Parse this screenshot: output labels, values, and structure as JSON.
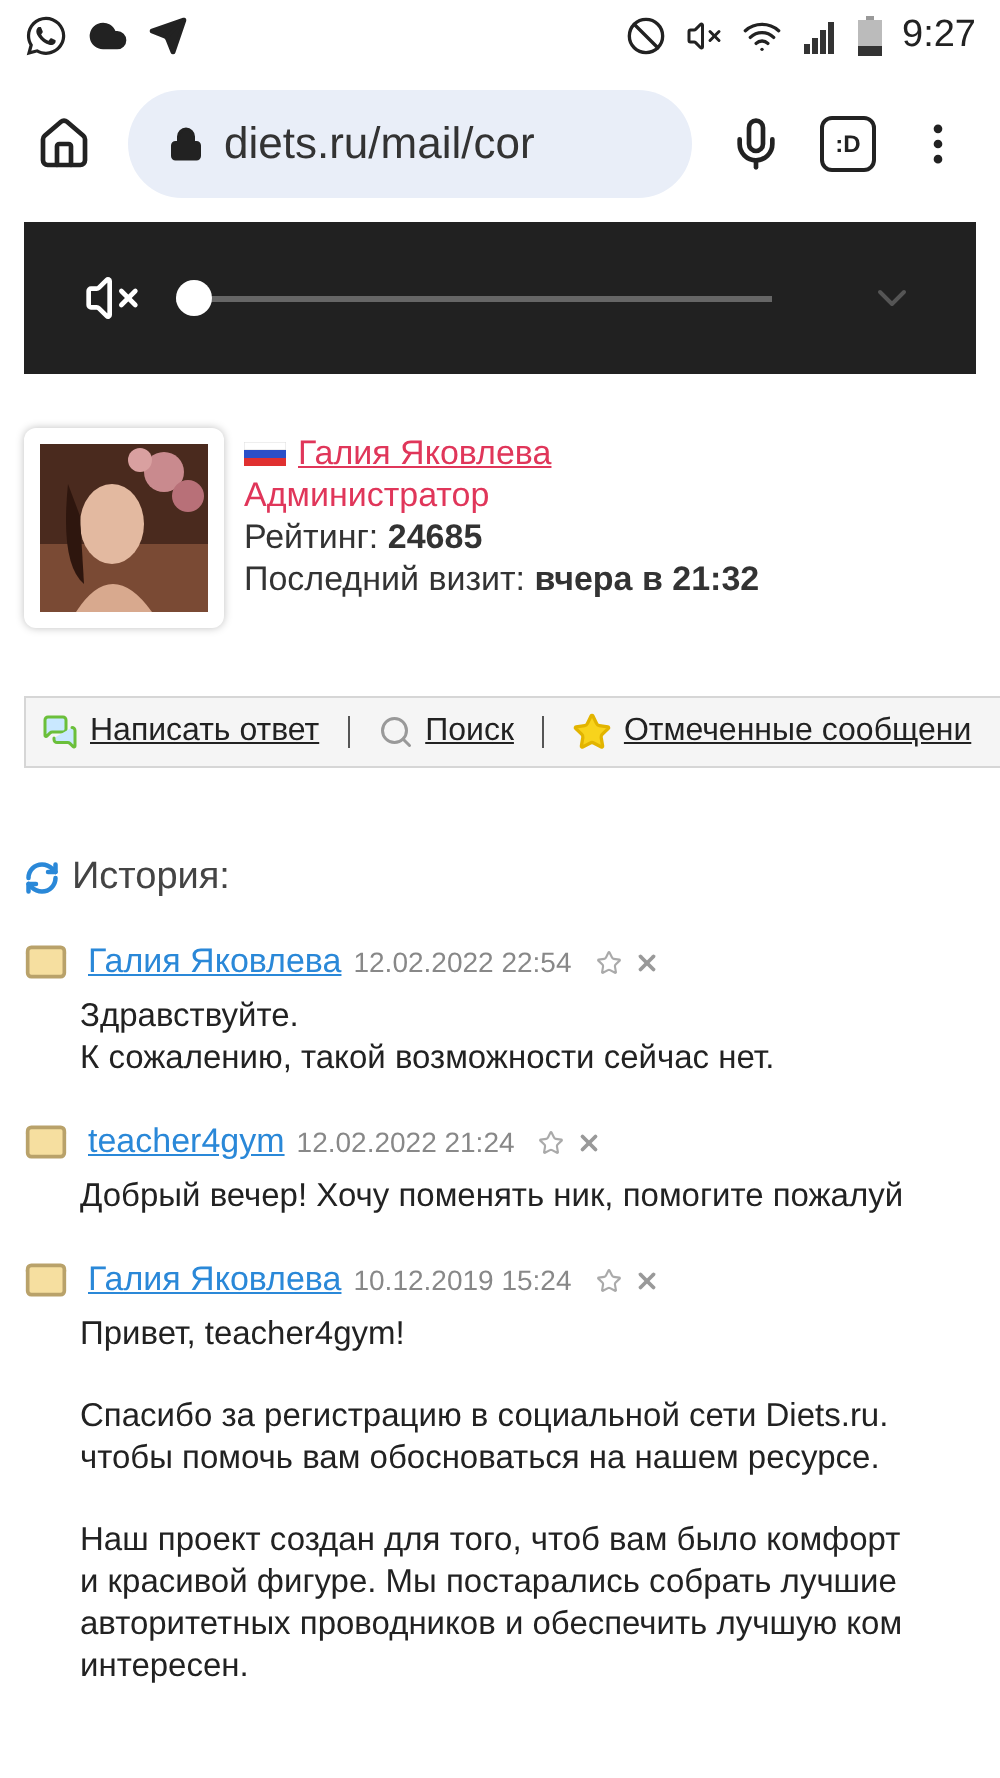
{
  "status_bar": {
    "time": "9:27"
  },
  "browser": {
    "url": "diets.ru/mail/cor",
    "tab_switcher": ":D"
  },
  "media_overlay": {
    "muted": true,
    "level": 0
  },
  "profile": {
    "name": "Галия Яковлева",
    "role": "Администратор",
    "rating_label": "Рейтинг:",
    "rating": "24685",
    "last_visit_label": "Последний визит:",
    "last_visit": "вчера в 21:32"
  },
  "toolbar": [
    {
      "kind": "reply",
      "label": "Написать ответ"
    },
    {
      "kind": "search",
      "label": "Поиск"
    },
    {
      "kind": "starred",
      "label": "Отмеченные сообщени"
    }
  ],
  "history": {
    "title": "История:",
    "messages": [
      {
        "author": "Галия Яковлева",
        "date": "12.02.2022 22:54",
        "paragraphs": [
          [
            "Здравствуйте.",
            "К сожалению, такой возможности сейчас нет."
          ]
        ]
      },
      {
        "author": "teacher4gym",
        "date": "12.02.2022 21:24",
        "paragraphs": [
          [
            "Добрый вечер! Хочу поменять ник, помогите пожалуй"
          ]
        ]
      },
      {
        "author": "Галия Яковлева",
        "date": "10.12.2019 15:24",
        "paragraphs": [
          [
            "Привет, teacher4gym!"
          ],
          [
            "Спасибо за регистрацию в социальной сети Diets.ru.",
            "чтобы помочь вам обосноваться на нашем ресурсе."
          ],
          [
            "Наш проект создан для того, чтоб вам было комфорт",
            "и красивой фигуре. Мы постарались собрать лучшие",
            "авторитетных проводников и обеспечить лучшую ком",
            "интересен."
          ]
        ]
      }
    ]
  }
}
